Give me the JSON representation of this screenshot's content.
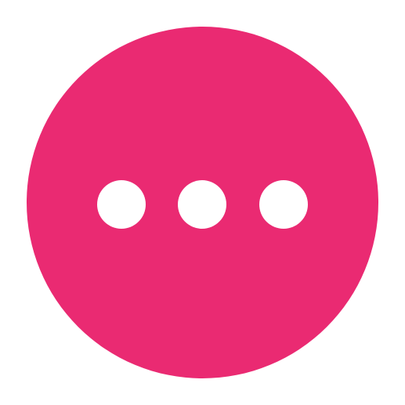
{
  "icon": {
    "name": "more-horizontal-icon",
    "background_color": "#EA2A72",
    "dot_color": "#FFFFFF",
    "dot_count": 3
  }
}
